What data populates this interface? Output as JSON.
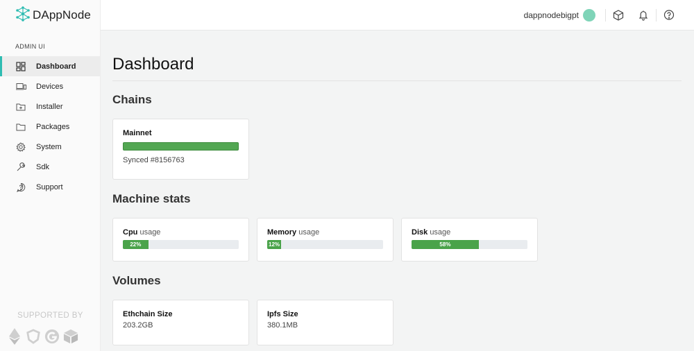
{
  "brand": {
    "name": "DAppNode",
    "accent": "#2fbcb2"
  },
  "sidebar": {
    "section_label": "ADMIN UI",
    "items": [
      {
        "label": "Dashboard",
        "icon": "dashboard-icon",
        "active": true
      },
      {
        "label": "Devices",
        "icon": "devices-icon"
      },
      {
        "label": "Installer",
        "icon": "installer-icon"
      },
      {
        "label": "Packages",
        "icon": "folder-icon"
      },
      {
        "label": "System",
        "icon": "gear-icon"
      },
      {
        "label": "Sdk",
        "icon": "wrench-icon"
      },
      {
        "label": "Support",
        "icon": "support-icon"
      }
    ],
    "supported_by": "SUPPORTED BY",
    "sponsors": [
      "ethereum-logo",
      "aragon-logo",
      "giveth-logo",
      "cube-logo"
    ]
  },
  "topbar": {
    "username": "dappnodebigpt",
    "icons": [
      "package-icon",
      "bell-icon",
      "help-icon"
    ]
  },
  "main": {
    "title": "Dashboard",
    "chains": {
      "title": "Chains",
      "items": [
        {
          "name": "Mainnet",
          "status": "Synced #8156763",
          "progress": 100
        }
      ]
    },
    "machine_stats": {
      "title": "Machine stats",
      "items": [
        {
          "name": "Cpu",
          "suffix": "usage",
          "percent": 22,
          "label": "22%"
        },
        {
          "name": "Memory",
          "suffix": "usage",
          "percent": 12,
          "label": "12%"
        },
        {
          "name": "Disk",
          "suffix": "usage",
          "percent": 58,
          "label": "58%"
        }
      ]
    },
    "volumes": {
      "title": "Volumes",
      "items": [
        {
          "name": "Ethchain Size",
          "value": "203.2GB"
        },
        {
          "name": "Ipfs Size",
          "value": "380.1MB"
        }
      ]
    }
  },
  "colors": {
    "progress_fill": "#4aa34a",
    "progress_track": "#e9ecef",
    "avatar": "#7fd4b8"
  }
}
